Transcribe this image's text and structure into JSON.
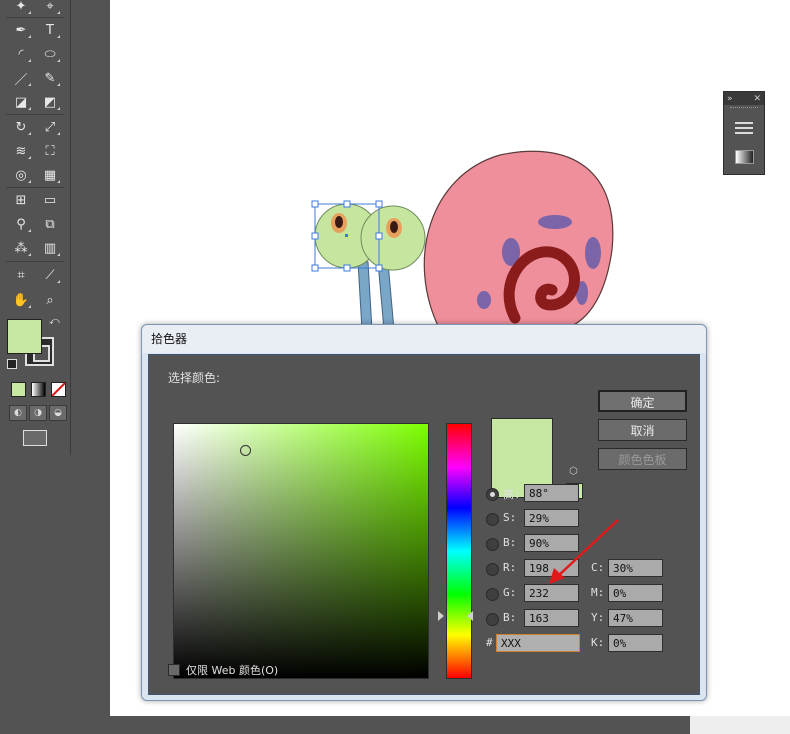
{
  "colors": {
    "fill": "#c6e8a3",
    "dialog_preview": "#c6e8a3",
    "websafe_swatch": "#cceea3",
    "shell": "#c9e6a4",
    "snail": "#ee8f9b",
    "spots": "#7b64a8",
    "swirl": "#8b1c1c"
  },
  "dialog": {
    "title": "拾色器",
    "select_label": "选择颜色:",
    "buttons": {
      "ok": "确定",
      "cancel": "取消",
      "swatches": "颜色色板"
    },
    "hsb": [
      {
        "label": "高:",
        "value": "88°"
      },
      {
        "label": "S:",
        "value": "29%"
      },
      {
        "label": "B:",
        "value": "90%"
      }
    ],
    "rgb": [
      {
        "label": "R:",
        "value": "198"
      },
      {
        "label": "G:",
        "value": "232"
      },
      {
        "label": "B:",
        "value": "163"
      }
    ],
    "cmyk": [
      {
        "label": "C:",
        "value": "30%"
      },
      {
        "label": "M:",
        "value": "0%"
      },
      {
        "label": "Y:",
        "value": "47%"
      },
      {
        "label": "K:",
        "value": "0%"
      }
    ],
    "hex": {
      "label": "#",
      "value": "XXX"
    },
    "websafe_only": "仅限 Web 颜色(O)"
  },
  "tools": {
    "type_glyph": "T",
    "icons": [
      "magic-wand",
      "lasso",
      "pen",
      "type",
      "arc",
      "ellipse",
      "paintbrush",
      "pencil",
      "blob-brush",
      "eraser",
      "rotate",
      "scale",
      "warp",
      "free-transform",
      "shape-builder",
      "perspective-grid",
      "mesh",
      "gradient",
      "eyedropper",
      "blend",
      "symbol-sprayer",
      "column-graph",
      "artboard",
      "slice",
      "hand",
      "zoom"
    ]
  }
}
